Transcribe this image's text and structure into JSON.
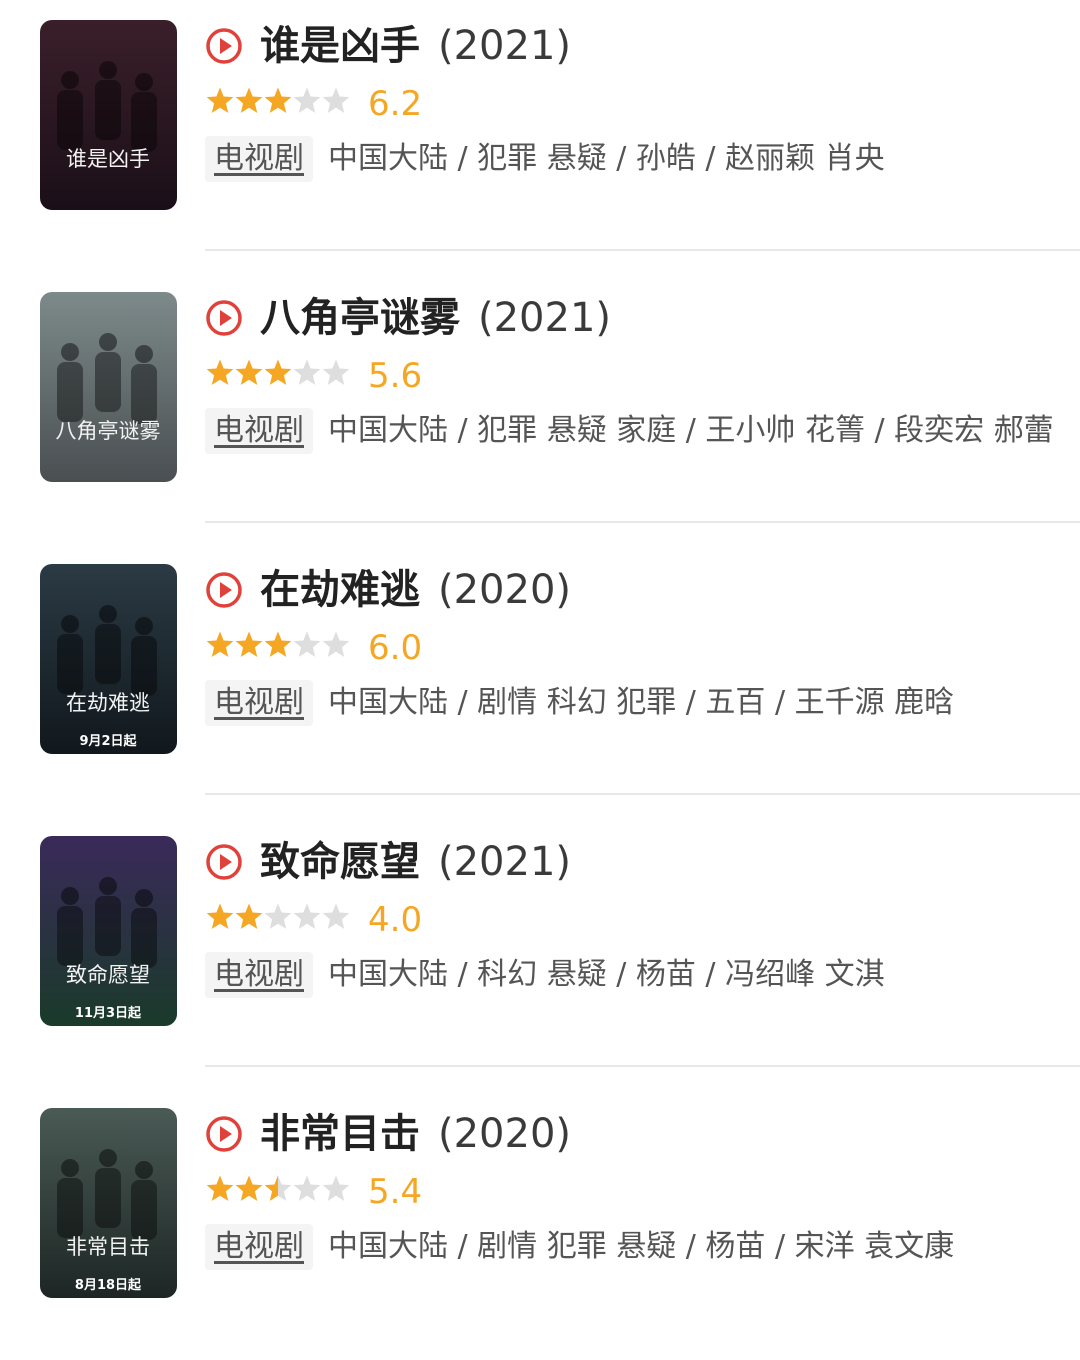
{
  "colors": {
    "play_icon": "#e0413a",
    "star_filled": "#f5a623",
    "star_empty": "#dedede",
    "rating_text": "#f5a623"
  },
  "icons": {
    "play": "play-circle-icon",
    "star": "star-icon"
  },
  "items": [
    {
      "title": "谁是凶手",
      "year": "(2021)",
      "stars_filled": 3,
      "rating": "6.2",
      "tag": "电视剧",
      "meta": "中国大陆 / 犯罪 悬疑 / 孙皓 / 赵丽颖 肖央",
      "poster_text": "谁是凶手",
      "poster_colors": [
        "#3a1f2a",
        "#1a0f18"
      ]
    },
    {
      "title": "八角亭谜雾",
      "year": "(2021)",
      "stars_filled": 3,
      "rating": "5.6",
      "tag": "电视剧",
      "meta": "中国大陆 / 犯罪 悬疑 家庭 / 王小帅 花箐 / 段奕宏 郝蕾",
      "poster_text": "八角亭谜雾",
      "poster_colors": [
        "#7d8a8a",
        "#4a4f52"
      ]
    },
    {
      "title": "在劫难逃",
      "year": "(2020)",
      "stars_filled": 3,
      "rating": "6.0",
      "tag": "电视剧",
      "meta": "中国大陆 / 剧情 科幻 犯罪 / 五百 / 王千源 鹿晗",
      "poster_text": "在劫难逃",
      "poster_caption": "9月2日起",
      "poster_colors": [
        "#2b3a44",
        "#11181d"
      ]
    },
    {
      "title": "致命愿望",
      "year": "(2021)",
      "stars_filled": 2,
      "rating": "4.0",
      "tag": "电视剧",
      "meta": "中国大陆 / 科幻 悬疑 / 杨苗 / 冯绍峰 文淇",
      "poster_text": "致命愿望",
      "poster_caption": "11月3日起",
      "poster_colors": [
        "#3a2a5a",
        "#1a3a2a"
      ]
    },
    {
      "title": "非常目击",
      "year": "(2020)",
      "stars_filled": 2.5,
      "rating": "5.4",
      "tag": "电视剧",
      "meta": "中国大陆 / 剧情 犯罪 悬疑 / 杨苗 / 宋洋 袁文康",
      "poster_text": "非常目击",
      "poster_caption": "8月18日起",
      "poster_colors": [
        "#4a5a55",
        "#1d2624"
      ]
    }
  ]
}
